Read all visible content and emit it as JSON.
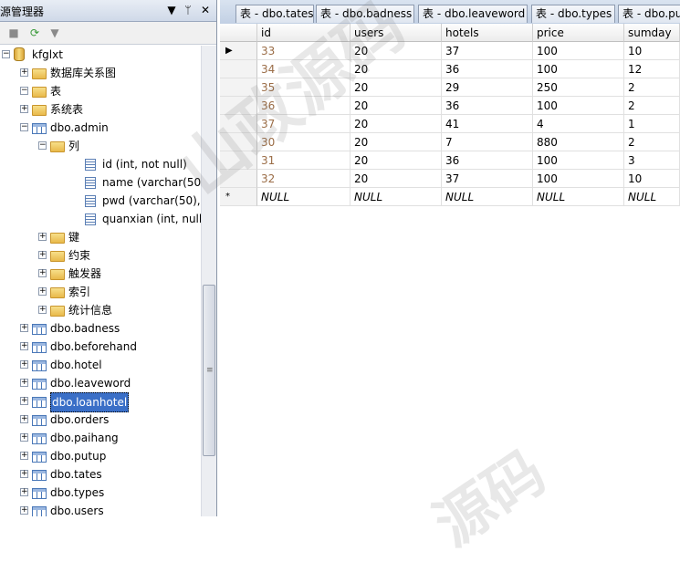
{
  "explorer": {
    "title": "源管理器",
    "buttons": [
      "▼",
      "ᛘ",
      "✕"
    ],
    "toolbar_icons": [
      "stop-icon",
      "refresh-icon",
      "filter-icon"
    ],
    "tree": [
      {
        "label": "kfglxt",
        "level": 0,
        "icon": "database-icon",
        "expander": "−"
      },
      {
        "label": "数据库关系图",
        "level": 1,
        "icon": "folder-icon",
        "expander": "+"
      },
      {
        "label": "表",
        "level": 1,
        "icon": "folder-icon",
        "expander": "−"
      },
      {
        "label": "系统表",
        "level": 2,
        "icon": "folder-icon",
        "expander": "+"
      },
      {
        "label": "dbo.admin",
        "level": 2,
        "icon": "table-icon",
        "expander": "−"
      },
      {
        "label": "列",
        "level": 3,
        "icon": "folder-icon",
        "expander": "−"
      },
      {
        "label": "id (int, not null)",
        "level": 4,
        "icon": "column-icon",
        "expander": ""
      },
      {
        "label": "name (varchar(50), r",
        "level": 4,
        "icon": "column-icon",
        "expander": ""
      },
      {
        "label": "pwd (varchar(50), r",
        "level": 4,
        "icon": "column-icon",
        "expander": ""
      },
      {
        "label": "quanxian (int, null)",
        "level": 4,
        "icon": "column-icon",
        "expander": ""
      },
      {
        "label": "键",
        "level": 3,
        "icon": "folder-icon",
        "expander": "+"
      },
      {
        "label": "约束",
        "level": 3,
        "icon": "folder-icon",
        "expander": "+"
      },
      {
        "label": "触发器",
        "level": 3,
        "icon": "folder-icon",
        "expander": "+"
      },
      {
        "label": "索引",
        "level": 3,
        "icon": "folder-icon",
        "expander": "+"
      },
      {
        "label": "统计信息",
        "level": 3,
        "icon": "folder-icon",
        "expander": "+"
      },
      {
        "label": "dbo.badness",
        "level": 2,
        "icon": "table-icon",
        "expander": "+"
      },
      {
        "label": "dbo.beforehand",
        "level": 2,
        "icon": "table-icon",
        "expander": "+"
      },
      {
        "label": "dbo.hotel",
        "level": 2,
        "icon": "table-icon",
        "expander": "+"
      },
      {
        "label": "dbo.leaveword",
        "level": 2,
        "icon": "table-icon",
        "expander": "+"
      },
      {
        "label": "dbo.loanhotel",
        "level": 2,
        "icon": "table-icon",
        "expander": "+",
        "selected": true
      },
      {
        "label": "dbo.orders",
        "level": 2,
        "icon": "table-icon",
        "expander": "+"
      },
      {
        "label": "dbo.paihang",
        "level": 2,
        "icon": "table-icon",
        "expander": "+"
      },
      {
        "label": "dbo.putup",
        "level": 2,
        "icon": "table-icon",
        "expander": "+"
      },
      {
        "label": "dbo.tates",
        "level": 2,
        "icon": "table-icon",
        "expander": "+"
      },
      {
        "label": "dbo.types",
        "level": 2,
        "icon": "table-icon",
        "expander": "+"
      },
      {
        "label": "dbo.users",
        "level": 2,
        "icon": "table-icon",
        "expander": "+"
      }
    ]
  },
  "tabs": [
    {
      "label": "表 - dbo.tates"
    },
    {
      "label": "表 - dbo.badness"
    },
    {
      "label": "表 - dbo.leaveword"
    },
    {
      "label": "表 - dbo.types"
    },
    {
      "label": "表 - dbo.pu"
    }
  ],
  "grid": {
    "columns": [
      "id",
      "users",
      "hotels",
      "price",
      "sumday"
    ],
    "rows": [
      {
        "marker": "▶",
        "cells": [
          "33",
          "20",
          "37",
          "100",
          "10"
        ]
      },
      {
        "marker": "",
        "cells": [
          "34",
          "20",
          "36",
          "100",
          "12"
        ]
      },
      {
        "marker": "",
        "cells": [
          "35",
          "20",
          "29",
          "250",
          "2"
        ]
      },
      {
        "marker": "",
        "cells": [
          "36",
          "20",
          "36",
          "100",
          "2"
        ]
      },
      {
        "marker": "",
        "cells": [
          "37",
          "20",
          "41",
          "4",
          "1"
        ]
      },
      {
        "marker": "",
        "cells": [
          "30",
          "20",
          "7",
          "880",
          "2"
        ]
      },
      {
        "marker": "",
        "cells": [
          "31",
          "20",
          "36",
          "100",
          "3"
        ]
      },
      {
        "marker": "",
        "cells": [
          "32",
          "20",
          "37",
          "100",
          "10"
        ]
      },
      {
        "marker": "*",
        "cells": [
          "NULL",
          "NULL",
          "NULL",
          "NULL",
          "NULL"
        ]
      }
    ]
  },
  "watermark": "山政源码",
  "watermark2": "源码"
}
